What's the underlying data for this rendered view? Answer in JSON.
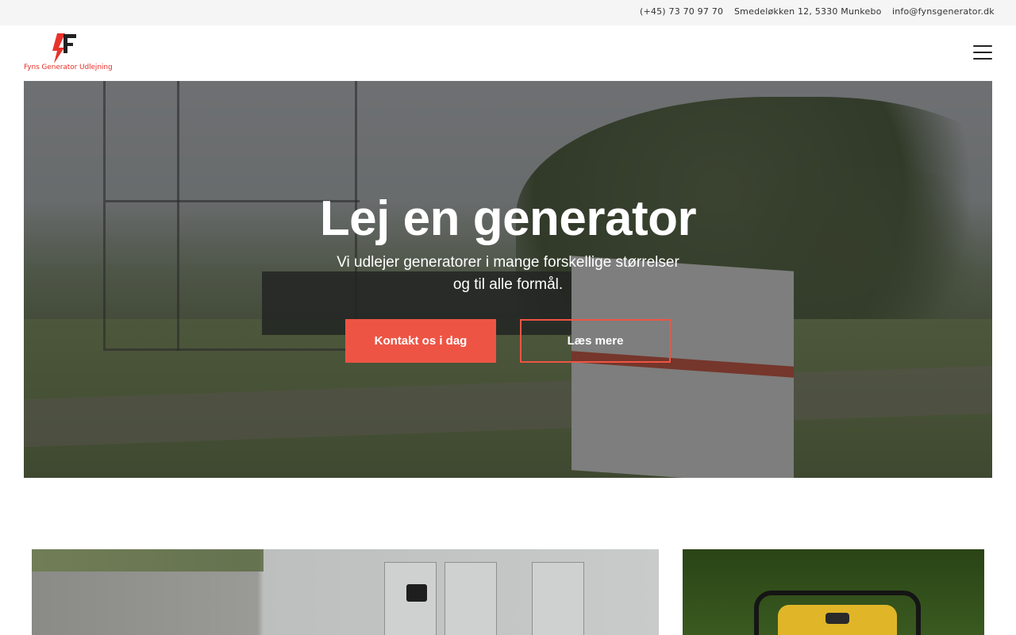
{
  "topbar": {
    "phone": "(+45) 73 70 97 70",
    "address": "Smedeløkken 12, 5330 Munkebo",
    "email": "info@fynsgenerator.dk"
  },
  "header": {
    "logo_text": "Fyns Generator Udlejning",
    "brand_color": "#e8322a",
    "menu_icon": "hamburger-menu-icon"
  },
  "hero": {
    "title": "Lej en generator",
    "subtitle_line1": "Vi udlejer generatorer i mange forskellige størrelser",
    "subtitle_line2": "og til alle formål.",
    "primary_button": "Kontakt os i dag",
    "secondary_button": "Læs mere",
    "accent_color": "#ee5444"
  }
}
